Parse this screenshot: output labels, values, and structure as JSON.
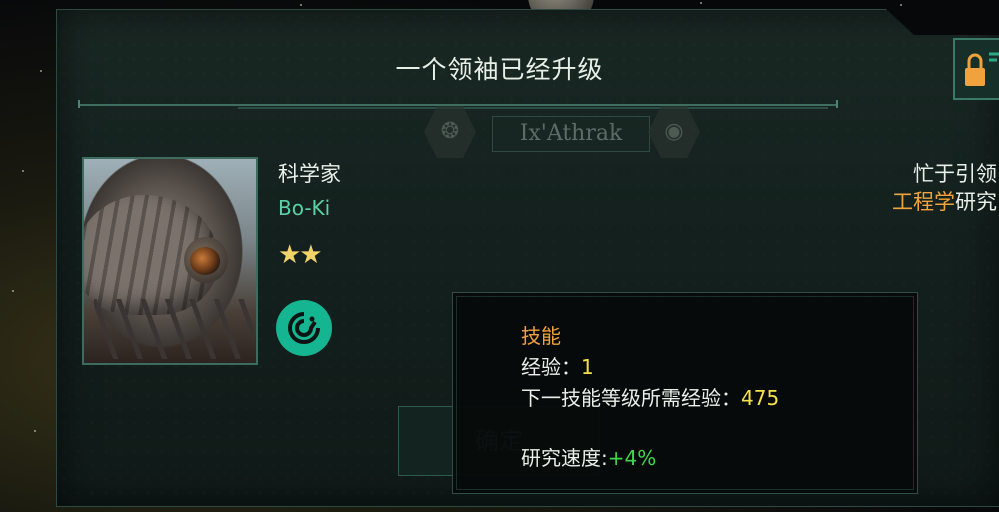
{
  "dialog": {
    "title": "一个领袖已经升级",
    "background_empire_name": "Ix'Athrak",
    "confirm_label": "确定"
  },
  "leader": {
    "role": "科学家",
    "name": "Bo-Ki",
    "stars": "★★",
    "trait_icon": "spiral-beast-icon",
    "status_line1": "忙于引领",
    "status_field": "工程学",
    "status_suffix": "研究"
  },
  "tooltip": {
    "title": "技能",
    "exp_label": "经验：",
    "exp_value": "1",
    "next_label": "下一技能等级所需经验：",
    "next_value": "475",
    "speed_label": "研究速度:",
    "speed_value": "+4%"
  },
  "colors": {
    "accent": "#59d3a6",
    "highlight": "#f0a33c",
    "value_yellow": "#f4e04a",
    "value_green": "#3fd64a"
  }
}
